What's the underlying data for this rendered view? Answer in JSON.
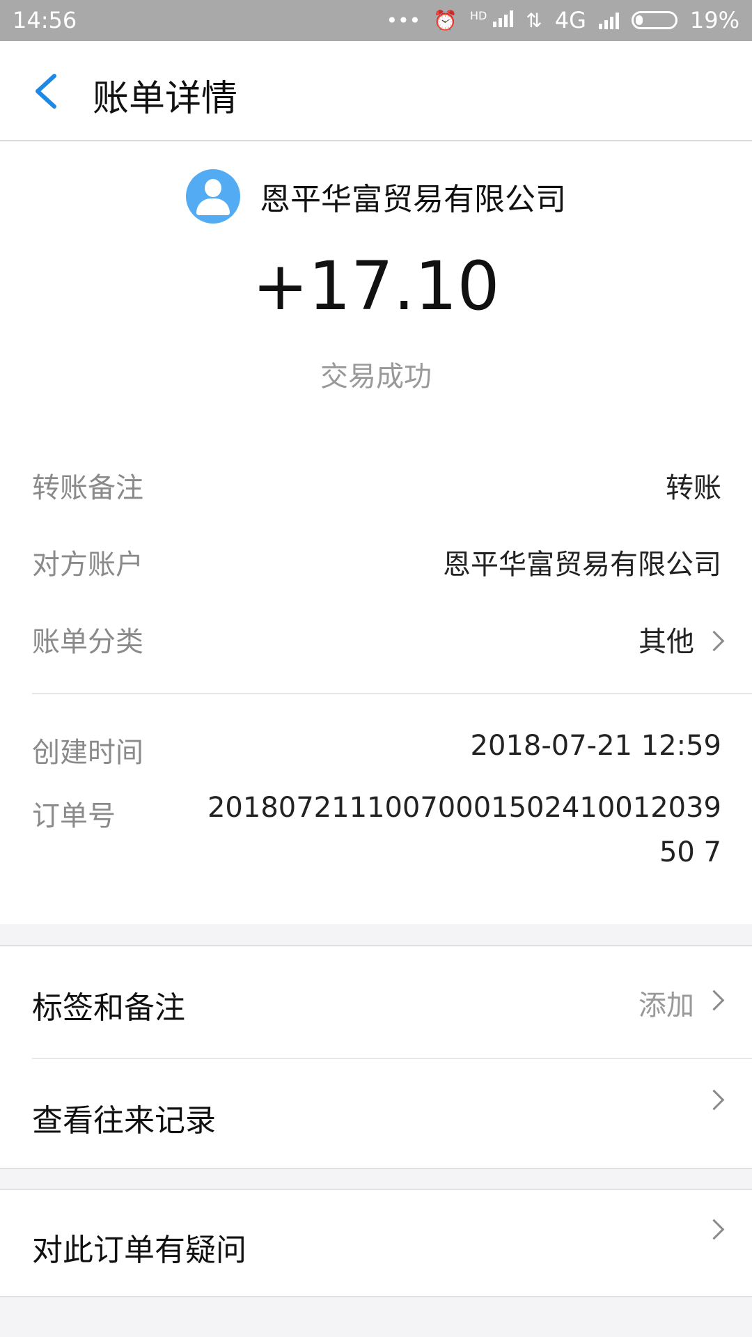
{
  "status_bar": {
    "time": "14:56",
    "network": "4G",
    "hd_label": "HD",
    "battery": "19%",
    "battery_level": 0.19
  },
  "header": {
    "title": "账单详情",
    "back_icon": "chevron-left-icon"
  },
  "summary": {
    "payee_name": "恩平华富贸易有限公司",
    "amount": "+17.10",
    "status": "交易成功",
    "avatar_color": "#53acf3"
  },
  "details": [
    {
      "label": "转账备注",
      "value": "转账"
    },
    {
      "label": "对方账户",
      "value": "恩平华富贸易有限公司"
    },
    {
      "label": "账单分类",
      "value": "其他"
    }
  ],
  "meta": [
    {
      "label": "创建时间",
      "value": "2018-07-21 12:59"
    },
    {
      "label": "订单号",
      "value": "2018072111007000150241001203950 7"
    }
  ],
  "actions": {
    "tags_label": "标签和备注",
    "tags_value": "添加",
    "history_label": "查看往来记录",
    "question_label": "对此订单有疑问"
  },
  "colors": {
    "accent": "#1e88e5",
    "status_bar": "#a9a9a9"
  }
}
